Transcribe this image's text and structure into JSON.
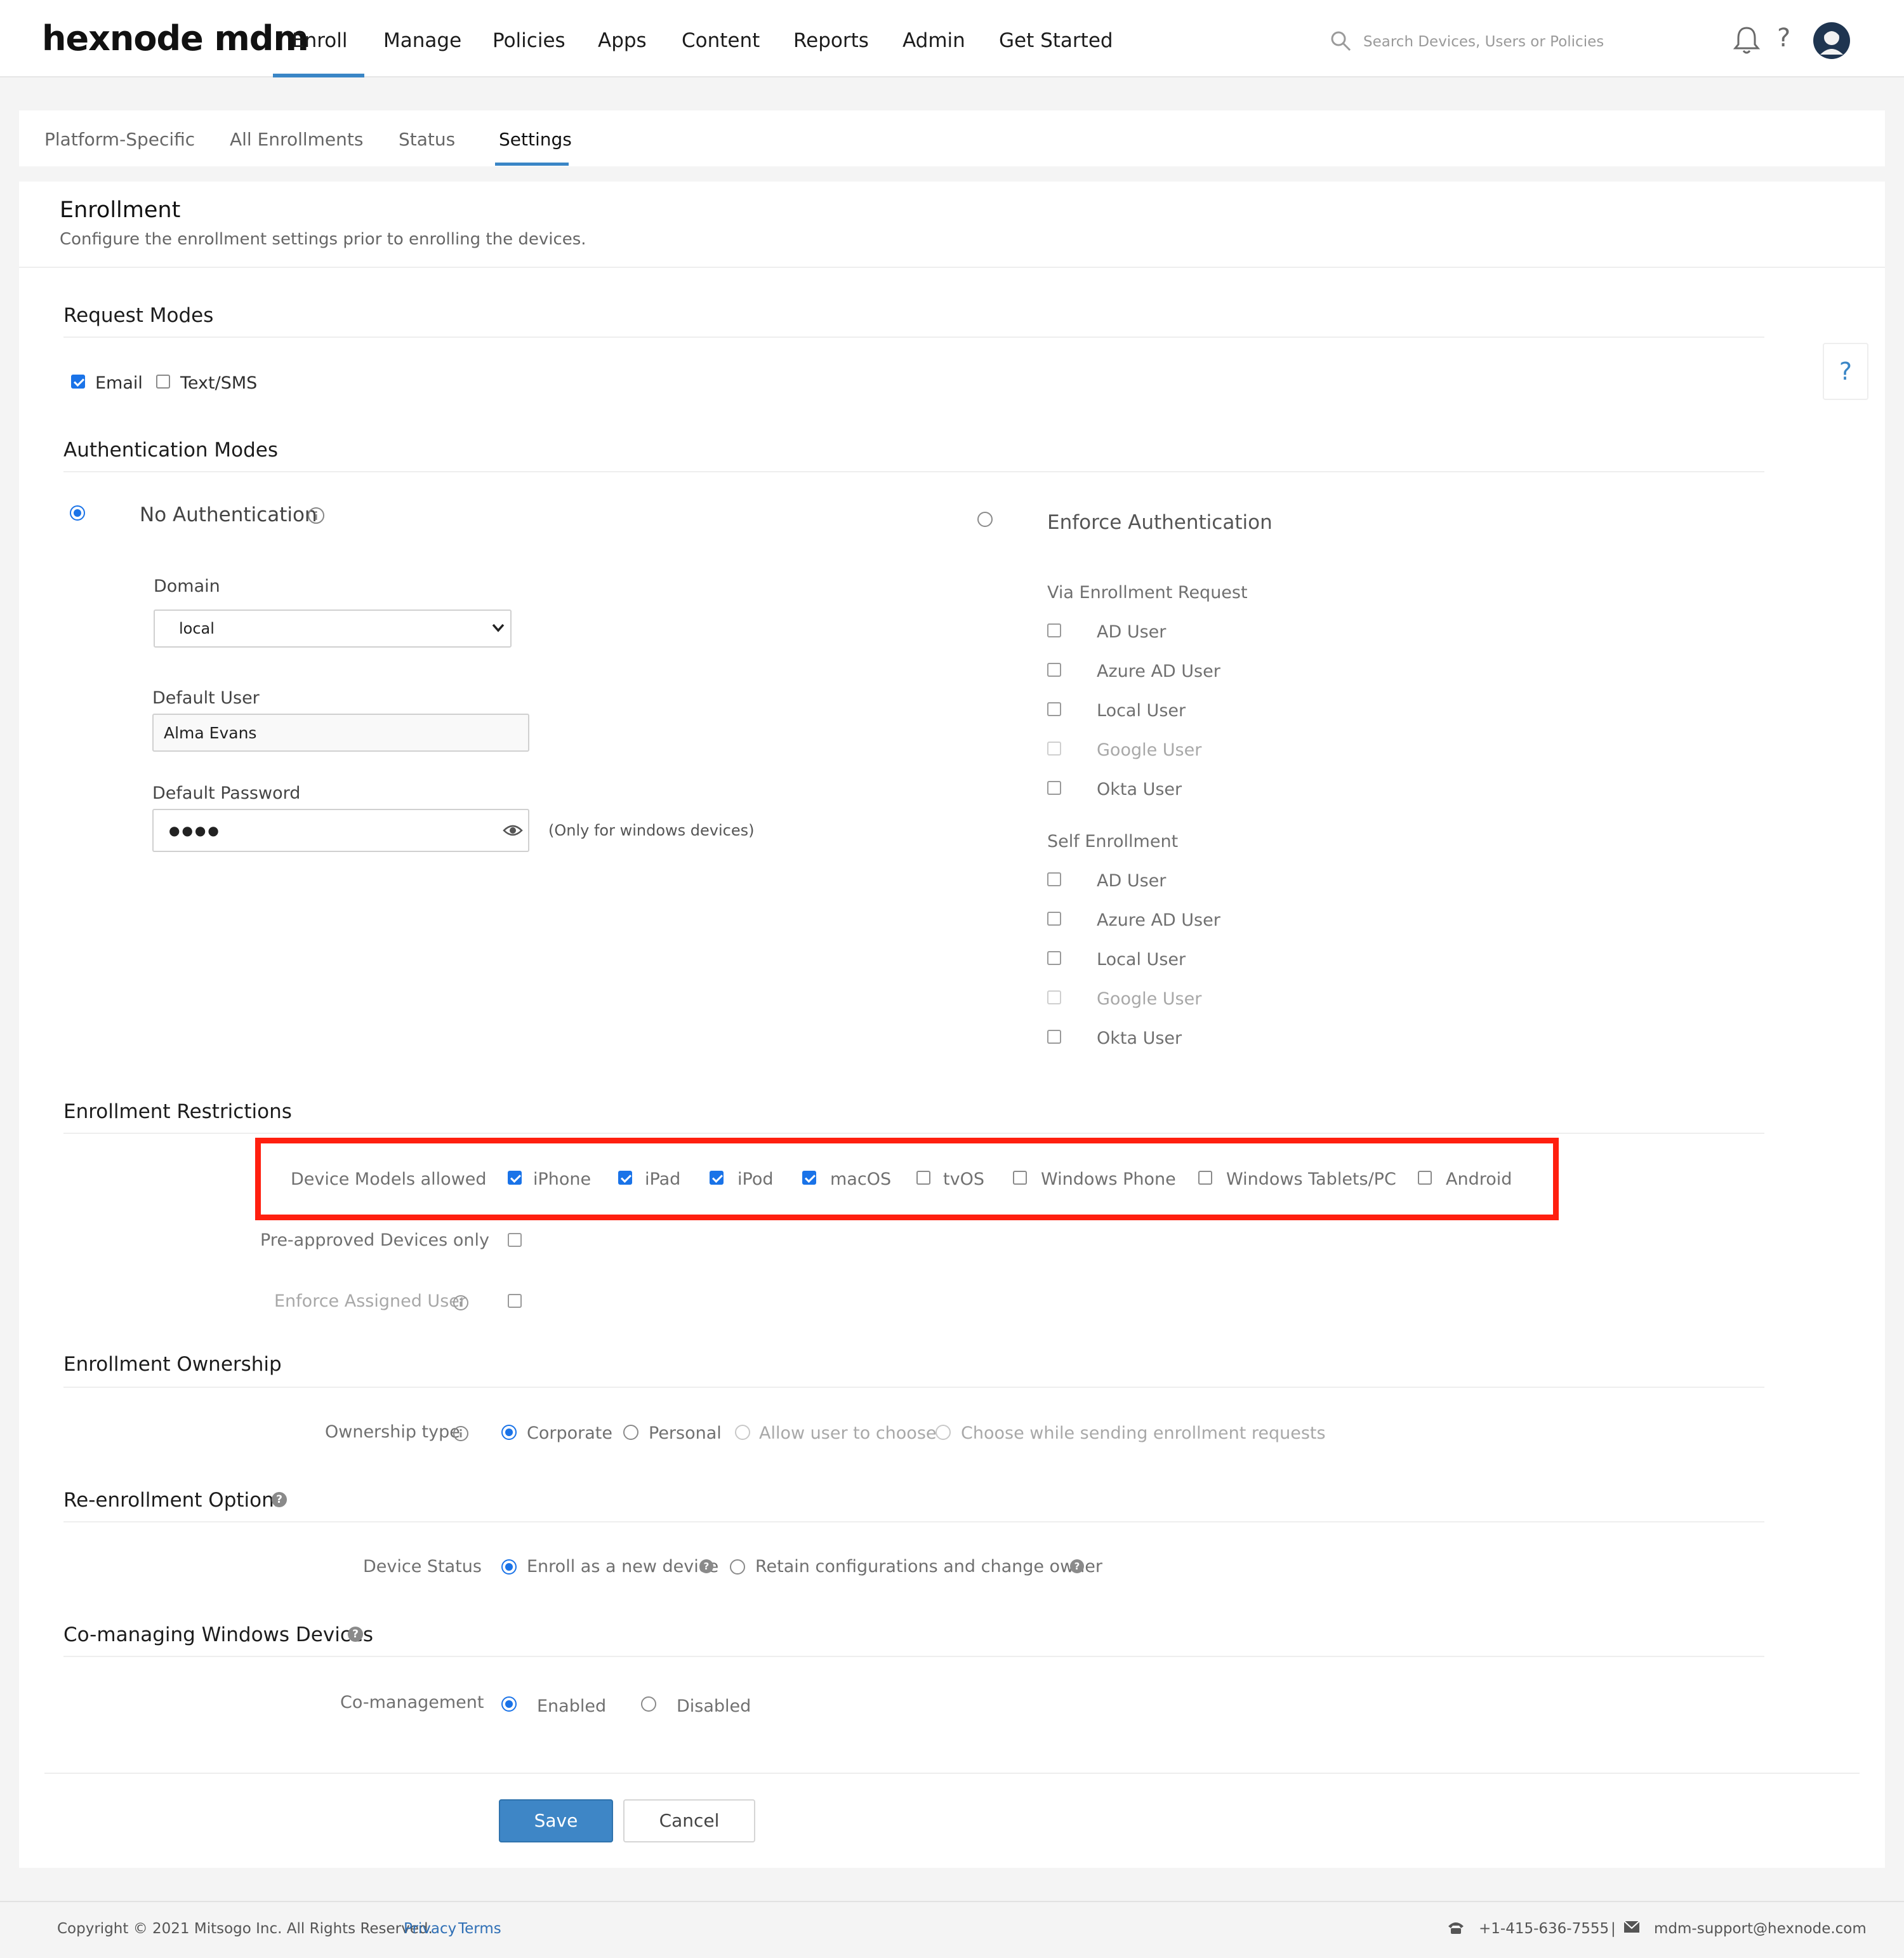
{
  "brand": {
    "logo": "hexnode mdm"
  },
  "nav": {
    "items": [
      "Enroll",
      "Manage",
      "Policies",
      "Apps",
      "Content",
      "Reports",
      "Admin",
      "Get Started"
    ],
    "active": "Enroll"
  },
  "search": {
    "placeholder": "Search Devices, Users or Policies"
  },
  "tabs": {
    "items": [
      "Platform-Specific",
      "All Enrollments",
      "Status",
      "Settings"
    ],
    "active": "Settings"
  },
  "page": {
    "title": "Enrollment",
    "subtitle": "Configure the enrollment settings prior to enrolling the devices."
  },
  "request_modes": {
    "title": "Request Modes",
    "email": "Email",
    "email_checked": true,
    "sms": "Text/SMS",
    "sms_checked": false
  },
  "auth_modes": {
    "title": "Authentication Modes",
    "no_auth": "No Authentication",
    "no_auth_selected": true,
    "domain_label": "Domain",
    "domain_value": "local",
    "default_user_label": "Default User",
    "default_user_value": "Alma Evans",
    "default_password_label": "Default Password",
    "default_password_mask": "●●●●",
    "windows_note": "(Only for windows devices)",
    "enforce": "Enforce Authentication",
    "enforce_selected": false,
    "via_request": "Via Enrollment Request",
    "via_request_options": [
      "AD User",
      "Azure AD User",
      "Local User",
      "Google User",
      "Okta User"
    ],
    "self_enrollment": "Self Enrollment",
    "self_options": [
      "AD User",
      "Azure AD User",
      "Local User",
      "Google User",
      "Okta User"
    ]
  },
  "restrictions": {
    "title": "Enrollment Restrictions",
    "device_models_label": "Device Models allowed",
    "models": [
      {
        "label": "iPhone",
        "checked": true
      },
      {
        "label": "iPad",
        "checked": true
      },
      {
        "label": "iPod",
        "checked": true
      },
      {
        "label": "macOS",
        "checked": true
      },
      {
        "label": "tvOS",
        "checked": false
      },
      {
        "label": "Windows Phone",
        "checked": false
      },
      {
        "label": "Windows Tablets/PC",
        "checked": false
      },
      {
        "label": "Android",
        "checked": false
      }
    ],
    "preapproved_label": "Pre-approved Devices only",
    "preapproved_checked": false,
    "enforce_user_label": "Enforce Assigned User",
    "enforce_user_checked": false
  },
  "ownership": {
    "title": "Enrollment Ownership",
    "type_label": "Ownership type",
    "options": [
      "Corporate",
      "Personal",
      "Allow user to choose",
      "Choose while sending enrollment requests"
    ],
    "selected": "Corporate"
  },
  "reenroll": {
    "title": "Re-enrollment Options",
    "status_label": "Device Status",
    "options": [
      "Enroll as a new device",
      "Retain configurations and change owner"
    ],
    "selected": "Enroll as a new device"
  },
  "comanage": {
    "title": "Co-managing Windows Devices",
    "label": "Co-management",
    "options": [
      "Enabled",
      "Disabled"
    ],
    "selected": "Enabled"
  },
  "actions": {
    "save": "Save",
    "cancel": "Cancel"
  },
  "help": {
    "label": "?"
  },
  "footer": {
    "copyright": "Copyright © 2021 Mitsogo Inc. All Rights Reserved.",
    "privacy": "Privacy",
    "terms": "Terms",
    "phone": "+1-415-636-7555",
    "divider": "|",
    "email": "mdm-support@hexnode.com"
  },
  "colors": {
    "accent": "#3a86c6",
    "checkbox": "#1a73e8",
    "highlight": "#ff1f0f"
  }
}
